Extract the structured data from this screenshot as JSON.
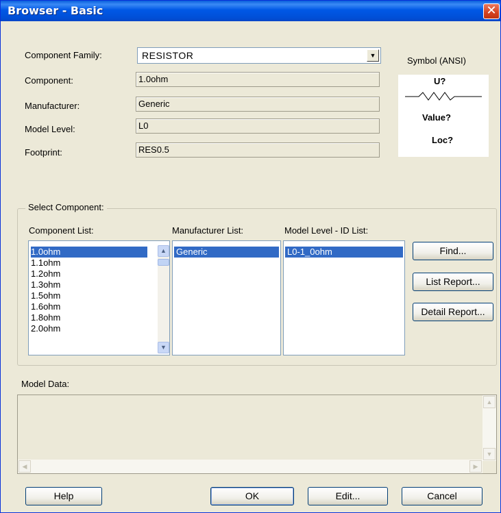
{
  "window": {
    "title": "Browser - Basic",
    "close_glyph": "✕"
  },
  "fields": {
    "family_label": "Component Family:",
    "family_value": "RESISTOR",
    "component_label": "Component:",
    "component_value": "1.0ohm",
    "manufacturer_label": "Manufacturer:",
    "manufacturer_value": "Generic",
    "model_level_label": "Model Level:",
    "model_level_value": "L0",
    "footprint_label": "Footprint:",
    "footprint_value": "RES0.5"
  },
  "symbol": {
    "label": "Symbol (ANSI)",
    "ref": "U?",
    "value": "Value?",
    "loc": "Loc?"
  },
  "select": {
    "group_label": "Select Component:",
    "component_list_label": "Component List:",
    "manufacturer_list_label": "Manufacturer List:",
    "model_list_label": "Model Level - ID List:",
    "components": [
      "1.0ohm",
      "1.1ohm",
      "1.2ohm",
      "1.3ohm",
      "1.5ohm",
      "1.6ohm",
      "1.8ohm",
      "2.0ohm"
    ],
    "manufacturers": [
      "Generic"
    ],
    "models": [
      "L0-1_0ohm"
    ]
  },
  "buttons": {
    "find": "Find...",
    "list_report": "List Report...",
    "detail_report": "Detail Report...",
    "help": "Help",
    "ok": "OK",
    "edit": "Edit...",
    "cancel": "Cancel"
  },
  "model_data": {
    "label": "Model Data:"
  },
  "colors": {
    "titlebar": "#0058e6",
    "selection": "#316ac5",
    "face": "#ece9d8"
  }
}
